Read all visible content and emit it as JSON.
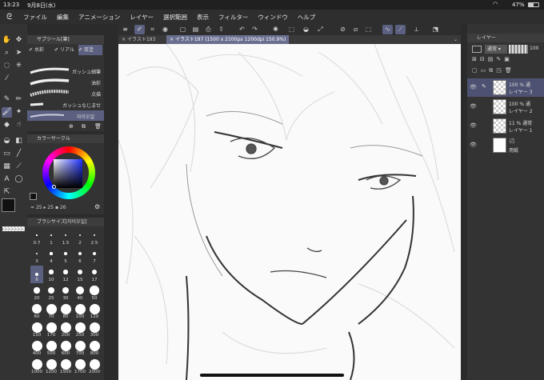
{
  "status": {
    "time": "13:23",
    "date": "9月8日(水)",
    "battery": "47%"
  },
  "menu": [
    "ファイル",
    "編集",
    "アニメーション",
    "レイヤー",
    "選択範囲",
    "表示",
    "フィルター",
    "ウィンドウ",
    "ヘルプ"
  ],
  "tabs": {
    "inactive": "イラスト193",
    "active": "イラスト197 (1500 x 2100px 1200dpi 150.9%)"
  },
  "subtool": {
    "title": "サブツール[筆]",
    "tabs": [
      "水彩",
      "リアル",
      "厚塗"
    ],
    "brushes": [
      "ガッシュ細筆",
      "油彩",
      "点描",
      "ガッシュなじませ",
      "자이오일"
    ]
  },
  "color": {
    "title": "カラーサークル",
    "values": [
      "25",
      "25",
      "26"
    ]
  },
  "brushsize": {
    "title": "ブラシサイズ[자이오일]",
    "sizes": [
      "0.7",
      "1",
      "1.5",
      "2",
      "2.5",
      "3",
      "4",
      "5",
      "6",
      "7",
      "8",
      "10",
      "12",
      "15",
      "17",
      "20",
      "25",
      "30",
      "40",
      "50",
      "60",
      "70",
      "80",
      "100",
      "120",
      "150",
      "170",
      "200",
      "250",
      "300",
      "400",
      "500",
      "600",
      "700",
      "800",
      "1000",
      "1200",
      "1500",
      "1700",
      "2000"
    ],
    "selected": "8"
  },
  "layers": {
    "title": "レイヤー",
    "blend": "通常",
    "opacity": "100",
    "items": [
      {
        "name": "100 % 通",
        "sub": "レイヤー 3",
        "selected": true
      },
      {
        "name": "100 % 通",
        "sub": "レイヤー 2",
        "selected": false
      },
      {
        "name": "11 % 通常",
        "sub": "レイヤー 1",
        "selected": false
      },
      {
        "name": "",
        "sub": "用紙",
        "selected": false
      }
    ]
  }
}
